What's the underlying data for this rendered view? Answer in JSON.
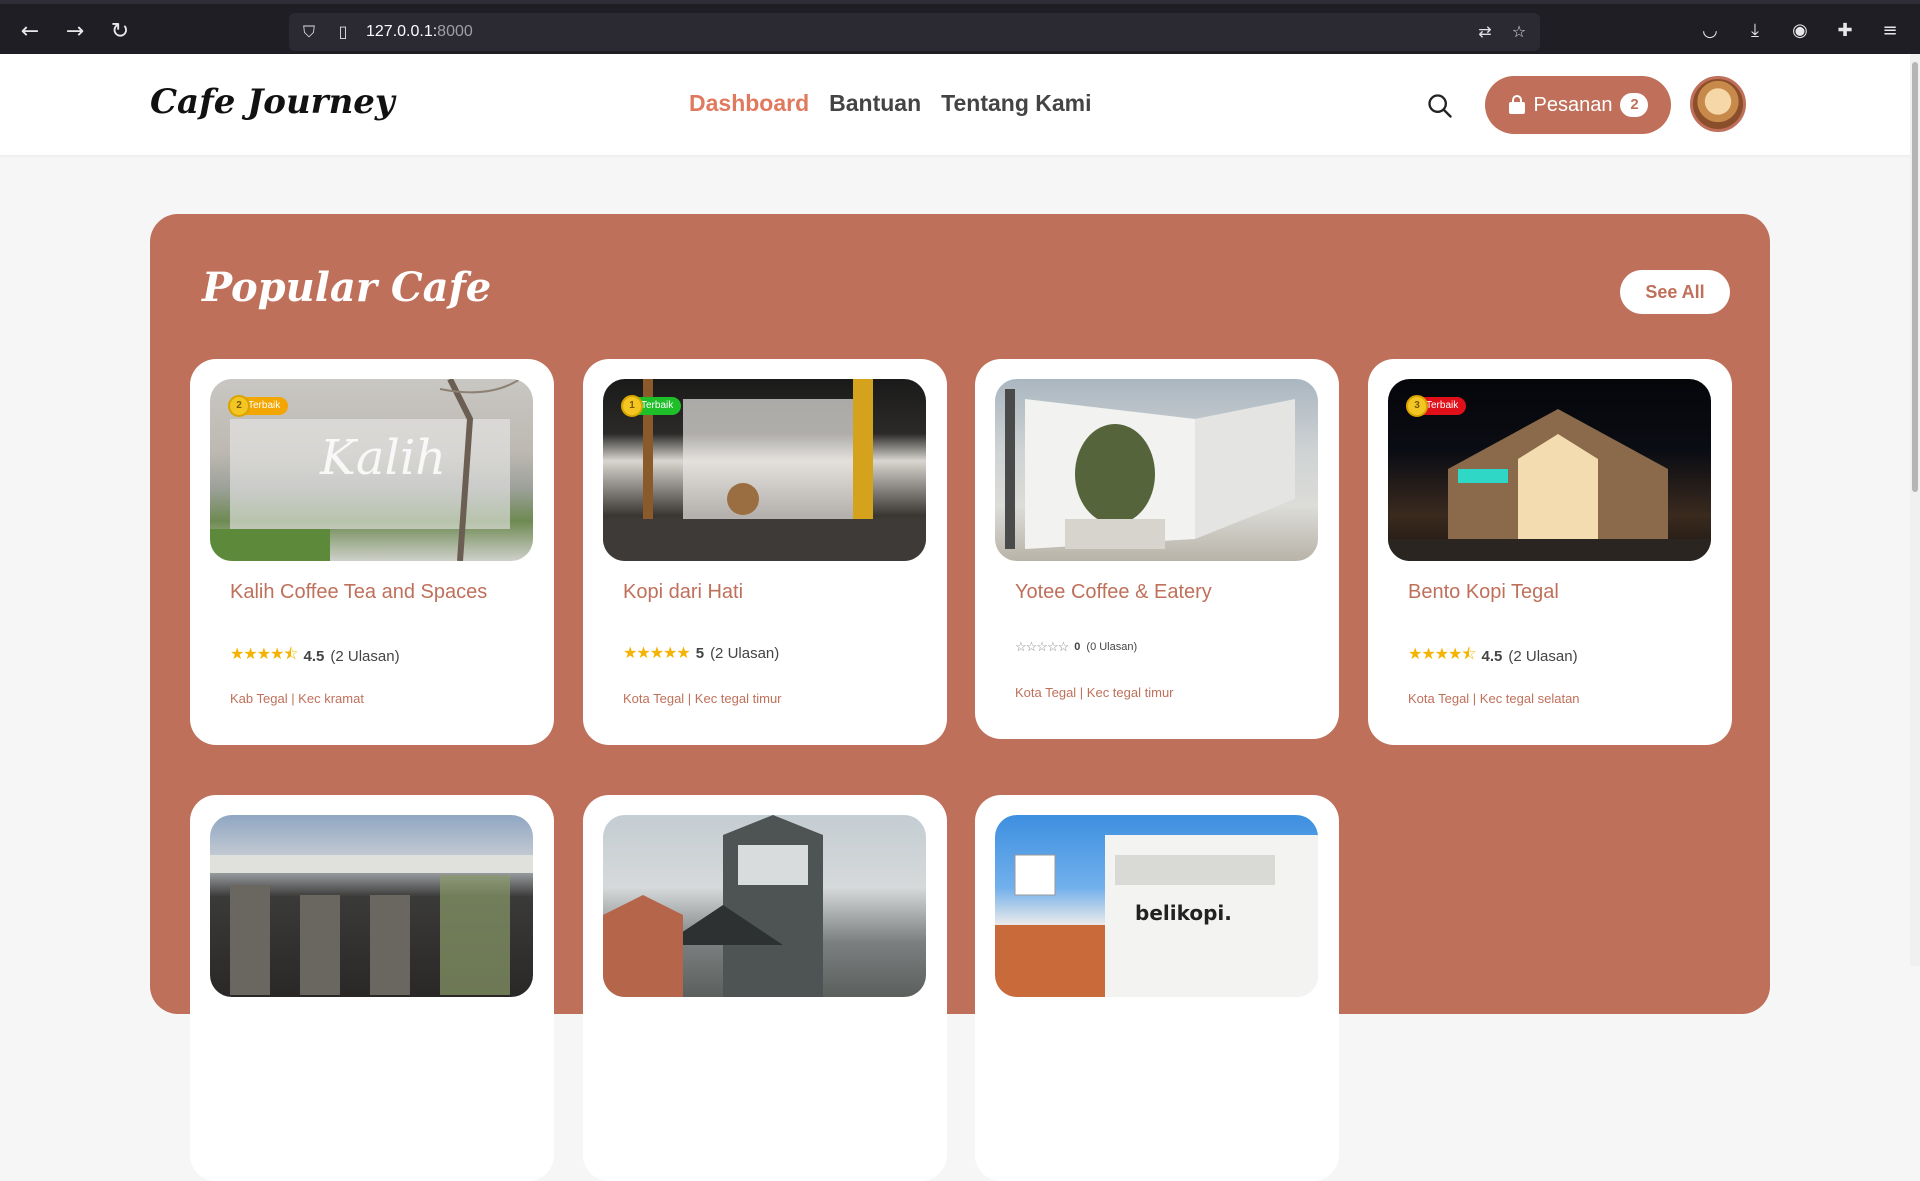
{
  "browser": {
    "url_host": "127.0.0.1:",
    "url_port": "8000"
  },
  "site": {
    "logo": "Cafe Journey",
    "menu": [
      "Dashboard",
      "Bantuan",
      "Tentang Kami"
    ],
    "order_label": "Pesanan",
    "order_count": "2"
  },
  "popular": {
    "title": "Popular Cafe",
    "see_all": "See All",
    "badge_label": "Terbaik",
    "cards": [
      {
        "name": "Kalih Coffee Tea and Spaces",
        "rank": "2",
        "badge_color": "#f3a500",
        "stars": "★★★★⯪",
        "score": "4.5",
        "reviews": "(2 Ulasan)",
        "location": "Kab Tegal | Kec kramat"
      },
      {
        "name": "Kopi dari Hati",
        "rank": "1",
        "badge_color": "#1fbf2a",
        "stars": "★★★★★",
        "score": "5",
        "reviews": "(2 Ulasan)",
        "location": "Kota Tegal | Kec tegal timur"
      },
      {
        "name": "Yotee Coffee & Eatery",
        "rank": "",
        "badge_color": "",
        "stars": "☆☆☆☆☆",
        "score": "0",
        "reviews": "(0 Ulasan)",
        "location": "Kota Tegal | Kec tegal timur"
      },
      {
        "name": "Bento Kopi Tegal",
        "rank": "3",
        "badge_color": "#e0101a",
        "stars": "★★★★⯪",
        "score": "4.5",
        "reviews": "(2 Ulasan)",
        "location": "Kota Tegal | Kec tegal selatan"
      }
    ],
    "second_row_sign": "belikopi."
  }
}
